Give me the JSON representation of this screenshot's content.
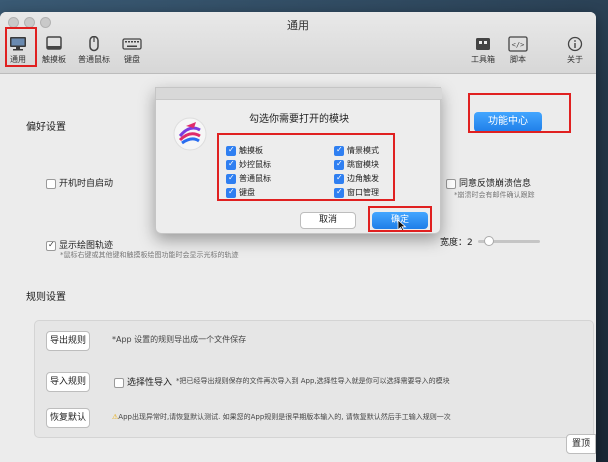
{
  "window": {
    "title": "通用"
  },
  "toolbar": {
    "left": [
      {
        "label": "通用",
        "icon": "monitor-icon"
      },
      {
        "label": "触摸板",
        "icon": "trackpad-icon"
      },
      {
        "label": "普通鼠标",
        "icon": "mouse-icon"
      },
      {
        "label": "键盘",
        "icon": "keyboard-icon"
      }
    ],
    "right": [
      {
        "label": "工具箱",
        "icon": "toolbox-icon"
      },
      {
        "label": "脚本",
        "icon": "script-icon"
      },
      {
        "label": "关于",
        "icon": "info-icon"
      }
    ]
  },
  "preferences": {
    "title": "偏好设置",
    "feature_center": "功能中心",
    "auto_launch": {
      "label": "开机时自启动",
      "checked": false
    },
    "crash_report": {
      "label": "同意反馈崩溃信息",
      "hint": "*崩溃时会有邮件确认跟踪",
      "checked": false
    },
    "show_trail": {
      "label": "显示绘图轨迹",
      "hint": "*鼠标右键或其他键和触摸板绘图功能时会显示光标的轨迹",
      "checked": true
    },
    "width_label": "宽度：",
    "width_value": "2"
  },
  "rules": {
    "title": "规则设置",
    "export_button": "导出规则",
    "export_hint": "*App 设置的规则导出成一个文件保存",
    "import_button": "导入规则",
    "selective_import": "选择性导入",
    "import_hint": "*把已经导出规则保存的文件再次导入到 App,选择性导入就是你可以选择需要导入的模块",
    "restore_button": "恢复默认",
    "restore_hint": "App出现异常时,请恢复默认测试. 如果您的App规则是很早期版本输入的, 请恢复默认然后手工输入规则一次",
    "warning_icon": "warning-icon"
  },
  "dialog": {
    "title": "勾选你需要打开的模块",
    "modules_left": [
      "触摸板",
      "妙控鼠标",
      "普通鼠标",
      "键盘"
    ],
    "modules_right": [
      "情景模式",
      "跳窗模块",
      "边角触发",
      "窗口管理"
    ],
    "cancel": "取消",
    "confirm": "确定"
  },
  "partial_right_button": "置顶",
  "colors": {
    "accent": "#1f7ee8",
    "highlight": "#e02020"
  }
}
